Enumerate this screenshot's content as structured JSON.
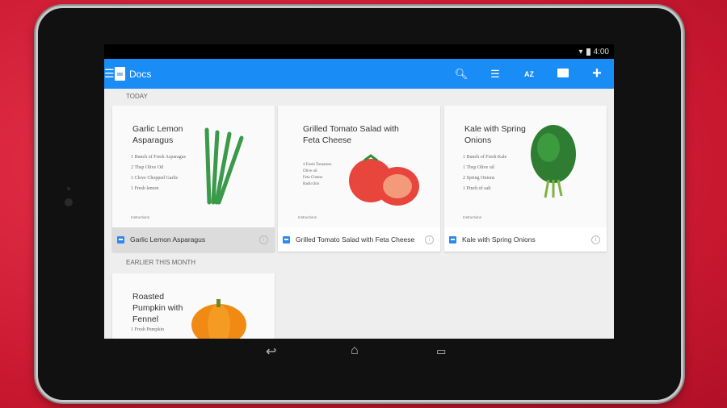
{
  "status": {
    "time": "4:00",
    "wifi_icon": "wifi-icon",
    "battery_icon": "battery-icon"
  },
  "appbar": {
    "title": "Docs",
    "color": "#1a8cf5",
    "actions": [
      "search-icon",
      "list-view-icon",
      "sort-az-icon",
      "folder-icon",
      "add-icon"
    ],
    "sort_label": "AZ"
  },
  "sections": [
    {
      "label": "TODAY",
      "docs": [
        {
          "title": "Garlic Lemon Asparagus",
          "thumb_title": "Garlic Lemon Asparagus",
          "ingredients": [
            "1 Bunch of Fresh Asparagus",
            "2 Tbsp Olive Oil",
            "1 Clove Chopped Garlic",
            "1 Fresh lemon"
          ],
          "instructions": "Instructions",
          "selected": true
        },
        {
          "title": "Grilled Tomato Salad with Feta Cheese",
          "thumb_title": "Grilled Tomato Salad with Feta Cheese",
          "ingredients": [
            "4 Fresh Tomatoes",
            "Olive oil",
            "Feta Cheese",
            "Radicchio"
          ],
          "instructions": "Instructions",
          "selected": false
        },
        {
          "title": "Kale with Spring Onions",
          "thumb_title": "Kale with Spring Onions",
          "ingredients": [
            "1 Bunch of Fresh Kale",
            "1 Tbsp Olive oil",
            "2 Spring Onions",
            "1 Pinch of salt"
          ],
          "instructions": "Instructions",
          "selected": false
        }
      ]
    },
    {
      "label": "EARLIER THIS MONTH",
      "docs": [
        {
          "thumb_title": "Roasted Pumpkin with Fennel",
          "ingredients": [
            "1 Fresh Pumpkin"
          ]
        }
      ]
    }
  ]
}
